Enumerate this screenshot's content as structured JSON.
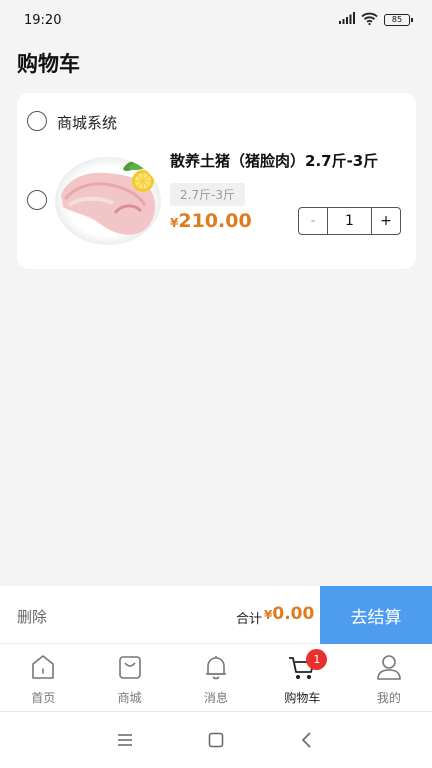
{
  "status_bar": {
    "time": "19:20",
    "battery": "85"
  },
  "page": {
    "title": "购物车"
  },
  "cart": {
    "store_name": "商城系统",
    "item": {
      "name": "散养土猪（猪脸肉）2.7斤-3斤",
      "spec": "2.7斤-3斤",
      "currency": "¥",
      "price": "210.00",
      "quantity": "1",
      "minus": "-",
      "plus": "+"
    }
  },
  "checkout": {
    "delete_label": "删除",
    "total_label": "合计",
    "currency": "¥",
    "total": "0.00",
    "submit_label": "去结算"
  },
  "tabs": [
    {
      "label": "首页",
      "icon": "home-icon"
    },
    {
      "label": "商城",
      "icon": "shopping-bag-icon"
    },
    {
      "label": "消息",
      "icon": "bell-icon"
    },
    {
      "label": "购物车",
      "icon": "cart-icon",
      "badge": "1",
      "active": true
    },
    {
      "label": "我的",
      "icon": "user-icon"
    }
  ],
  "colors": {
    "accent": "#4e9cf0",
    "price": "#e07c1e",
    "badge": "#e8302f"
  }
}
